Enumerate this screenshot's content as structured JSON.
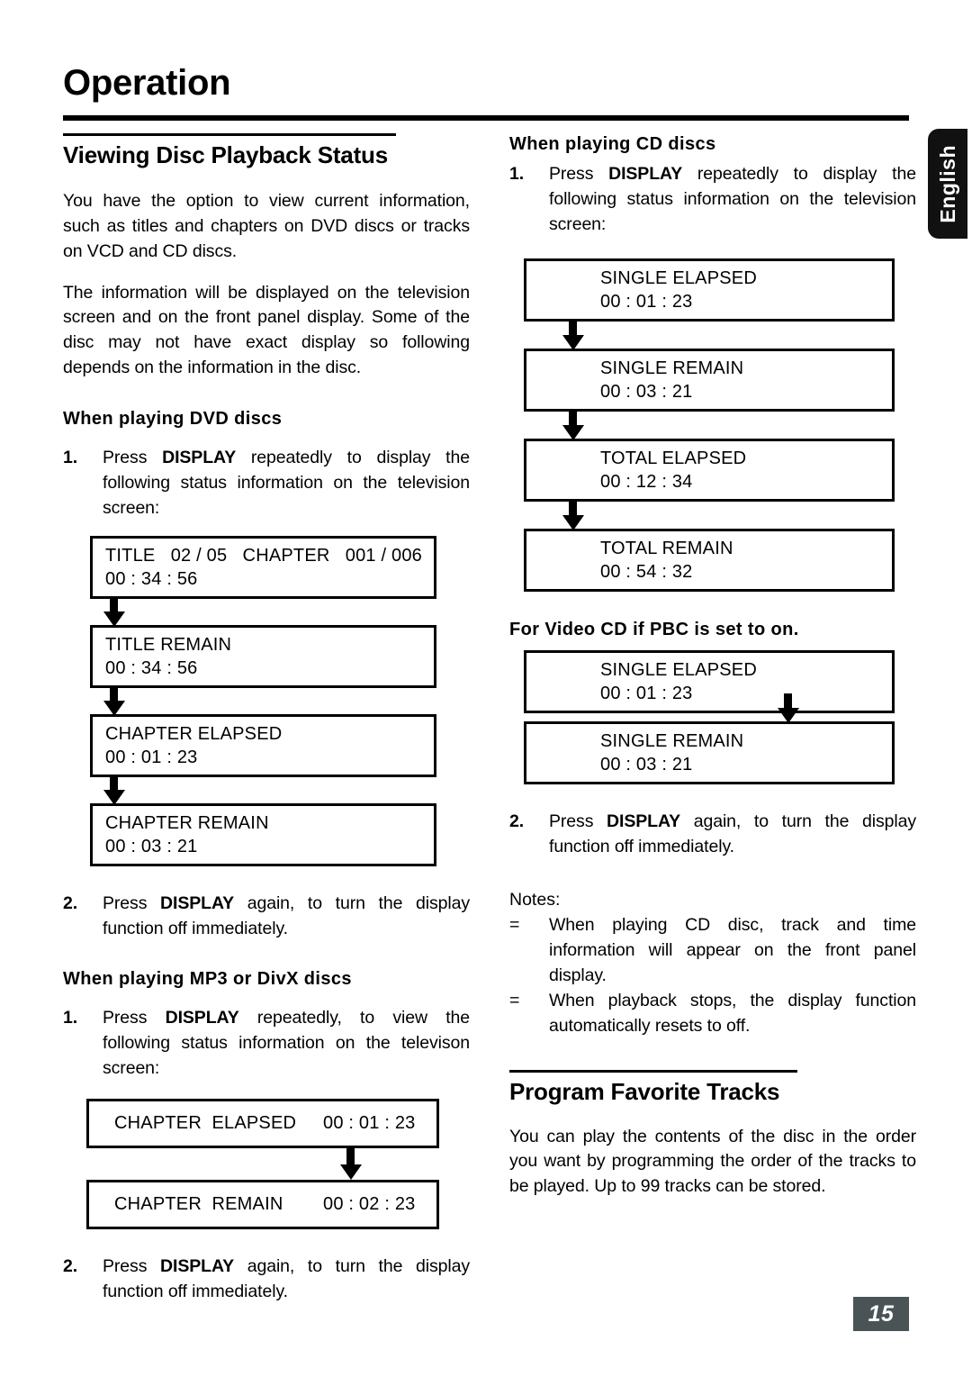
{
  "page": {
    "chapter_title": "Operation",
    "language_tab": "English",
    "page_number": "15"
  },
  "left_column": {
    "section_heading": "Viewing Disc Playback Status",
    "intro_paragraph_1": "You have the option to view current information, such as titles and chapters on DVD discs or tracks on VCD and CD discs.",
    "intro_paragraph_2": "The information will be displayed on the television screen and on the front panel display. Some of the disc may not have exact display so following depends on the information in the disc.",
    "dvd": {
      "sub_heading": "When playing DVD discs",
      "step1_num": "1.",
      "step1_pre": "Press ",
      "step1_bold": "DISPLAY",
      "step1_post": " repeatedly to display the following status information on the television screen:",
      "boxes": [
        {
          "line1": "TITLE   02 / 05   CHAPTER   001 / 006",
          "line2": "00 : 34 : 56"
        },
        {
          "line1": "TITLE REMAIN",
          "line2": "00 : 34 : 56"
        },
        {
          "line1": "CHAPTER ELAPSED",
          "line2": "00 : 01 : 23"
        },
        {
          "line1": "CHAPTER REMAIN",
          "line2": "00 : 03 : 21"
        }
      ],
      "step2_num": "2.",
      "step2_pre": "Press ",
      "step2_bold": "DISPLAY",
      "step2_post": " again, to turn the display function off immediately."
    },
    "mp3": {
      "sub_heading": "When playing MP3 or DivX discs",
      "step1_num": "1.",
      "step1_pre": "Press ",
      "step1_bold": "DISPLAY",
      "step1_post": " repeatedly, to view the following status information on the televison screen:",
      "boxes": [
        {
          "label": "CHAPTER  ELAPSED",
          "time": "00 : 01 : 23"
        },
        {
          "label": "CHAPTER  REMAIN",
          "time": "00 : 02 : 23"
        }
      ],
      "step2_num": "2.",
      "step2_pre": "Press ",
      "step2_bold": "DISPLAY",
      "step2_post": " again, to turn the display function off immediately."
    }
  },
  "right_column": {
    "cd": {
      "sub_heading": "When playing CD discs",
      "step1_num": "1.",
      "step1_pre": "Press ",
      "step1_bold": "DISPLAY",
      "step1_post": " repeatedly to display the following status information on the television screen:",
      "boxes": [
        {
          "line1": "SINGLE ELAPSED",
          "line2": "00 : 01 : 23"
        },
        {
          "line1": "SINGLE REMAIN",
          "line2": "00 : 03 : 21"
        },
        {
          "line1": "TOTAL ELAPSED",
          "line2": "00 : 12 : 34"
        },
        {
          "line1": "TOTAL REMAIN",
          "line2": "00 : 54 : 32"
        }
      ]
    },
    "pbc": {
      "sub_heading": "For Video CD if PBC is set to on.",
      "boxes": [
        {
          "line1": "SINGLE ELAPSED",
          "line2": "00 : 01 : 23"
        },
        {
          "line1": "SINGLE REMAIN",
          "line2": "00 : 03 : 21"
        }
      ],
      "step2_num": "2.",
      "step2_pre": "Press ",
      "step2_bold": "DISPLAY",
      "step2_post": " again, to turn the display function off immediately."
    },
    "notes": {
      "label": "Notes:",
      "items": [
        {
          "bullet": "=",
          "text": "When playing CD disc, track and time information will appear on the front panel display."
        },
        {
          "bullet": "=",
          "text": "When playback stops, the display function automatically resets to off."
        }
      ]
    },
    "program": {
      "section_heading": "Program Favorite Tracks",
      "paragraph": "You can play the contents of the disc in the order you want by programming the order of the tracks to be played. Up to 99 tracks can be stored."
    }
  }
}
